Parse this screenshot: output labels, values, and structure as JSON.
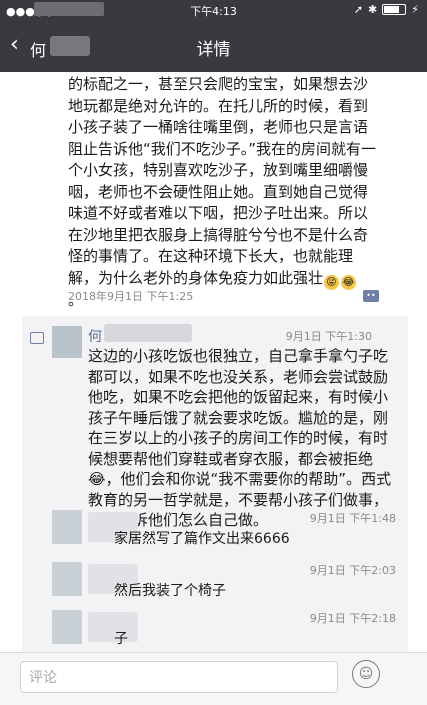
{
  "status": {
    "time": "下午4:13"
  },
  "nav": {
    "back_label": "何",
    "title": "详情"
  },
  "article": {
    "text": "的标配之一，甚至只会爬的宝宝，如果想去沙地玩都是绝对允许的。在托儿所的时候，看到小孩子装了一桶啥往嘴里倒，老师也只是言语阻止告诉他“我们不吃沙子。”我在的房间就有一个小女孩，特别喜欢吃沙子，放到嘴里细嚼慢咽，老师也不会硬性阻止她。直到她自己觉得味道不好或者难以下咽，把沙子吐出来。所以在沙地里把衣服身上搞得脏兮兮也不是什么奇怪的事情了。在这种环境下长大，也就能理解，为什么老外的身体免疫力如此强壮",
    "tail": "。",
    "date": "2018年9月1日 下午1:25"
  },
  "comments": {
    "main": {
      "name": "何",
      "time": "9月1日 下午1:30",
      "text": "这边的小孩吃饭也很独立，自己拿手拿勺子吃都可以，如果不吃也没关系，老师会尝试鼓励他吃，如果不吃会把他的饭留起来，有时候小孩子午睡后饿了就会要求吃饭。尴尬的是，刚在三岁以上的小孩子的房间工作的时候，有时候想要帮他们穿鞋或者穿衣服，都会被拒绝",
      "text2": "，他们会和你说“我不需要你的帮助”。西式教育的另一哲学就是，不要帮小孩子们做事，而是告诉他们怎么自己做。"
    },
    "replies": [
      {
        "time": "9月1日 下午1:48",
        "text": "家居然写了篇作文出来6666"
      },
      {
        "time": "9月1日 下午2:03",
        "text": "然后我装了个椅子"
      },
      {
        "time": "9月1日 下午2:18",
        "text": "子"
      }
    ]
  },
  "footer": {
    "placeholder": "评论"
  }
}
